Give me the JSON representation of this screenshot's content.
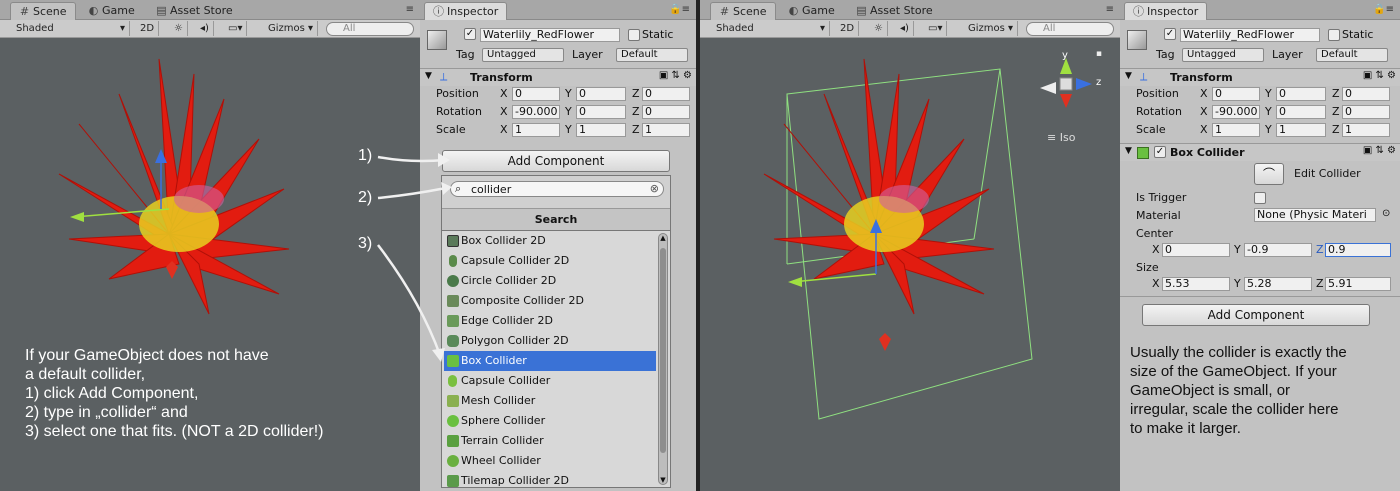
{
  "scene_tabs": {
    "scene": "Scene",
    "game": "Game",
    "asset_store": "Asset Store"
  },
  "scene_toolbar": {
    "shaded": "Shaded",
    "mode_2d": "2D",
    "gizmos": "Gizmos",
    "search_placeholder": "All"
  },
  "inspector": {
    "tab": "Inspector",
    "object_name": "Waterlily_RedFlower",
    "static_label": "Static",
    "tag_label": "Tag",
    "tag_value": "Untagged",
    "layer_label": "Layer",
    "layer_value": "Default",
    "transform": {
      "title": "Transform",
      "position_label": "Position",
      "rotation_label": "Rotation",
      "scale_label": "Scale",
      "axis_x": "X",
      "axis_y": "Y",
      "axis_z": "Z",
      "position": {
        "x": "0",
        "y": "0",
        "z": "0"
      },
      "rotation": {
        "x": "-90.000",
        "y": "0",
        "z": "0"
      },
      "scale": {
        "x": "1",
        "y": "1",
        "z": "1"
      }
    },
    "add_component": "Add Component"
  },
  "left_view": {
    "search_text": "collider",
    "search_header": "Search",
    "step_labels": [
      "1)",
      "2)",
      "3)"
    ],
    "components": [
      "Box Collider 2D",
      "Capsule Collider 2D",
      "Circle Collider 2D",
      "Composite Collider 2D",
      "Edge Collider 2D",
      "Polygon Collider 2D",
      "Box Collider",
      "Capsule Collider",
      "Mesh Collider",
      "Sphere Collider",
      "Terrain Collider",
      "Wheel Collider",
      "Tilemap Collider 2D"
    ],
    "selected_component": "Box Collider",
    "instructions": "If your GameObject does not have\na default collider,\n1) click Add Component,\n2) type in „collider“ and\n3) select one that fits. (NOT a 2D collider!)"
  },
  "right_view": {
    "gizmo_y": "y",
    "gizmo_z": "z",
    "iso": "Iso",
    "box_collider": {
      "title": "Box Collider",
      "edit": "Edit Collider",
      "is_trigger": "Is Trigger",
      "material_label": "Material",
      "material_value": "None (Physic Materi",
      "center_label": "Center",
      "size_label": "Size",
      "center": {
        "x": "0",
        "y": "-0.9",
        "z": "0.9"
      },
      "size": {
        "x": "5.53",
        "y": "5.28",
        "z": "5.91"
      }
    },
    "note": "Usually the collider is exactly the\nsize of the GameObject. If your\nGameObject is small, or\nirregular, scale the collider here\nto make it larger."
  },
  "colors": {
    "viewport": "#5b6062",
    "selection": "#3a72d6",
    "panel": "#c2c2c2"
  }
}
